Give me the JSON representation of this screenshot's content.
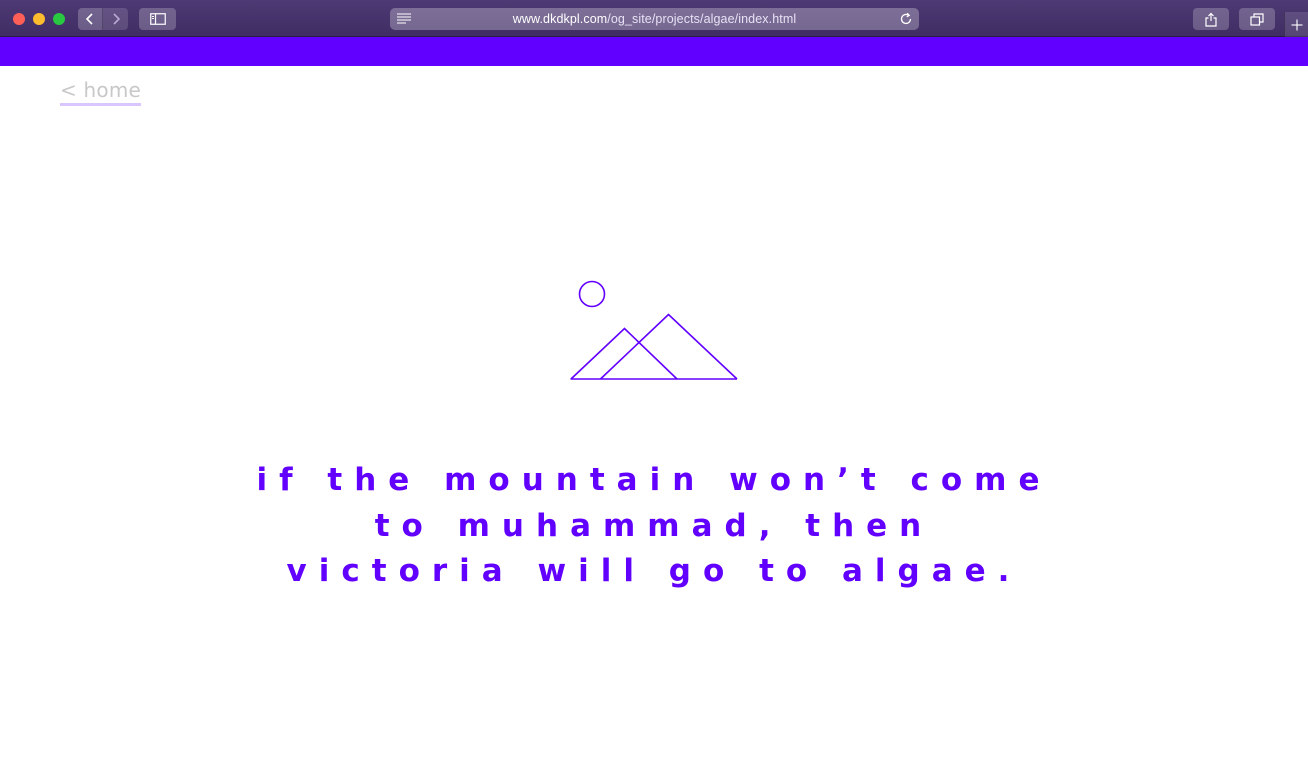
{
  "browser": {
    "url_host": "www.dkdkpl.com",
    "url_path": "/og_site/projects/algae/index.html",
    "icons": {
      "back": "chevron-left-icon",
      "forward": "chevron-right-icon",
      "sidebar": "sidebar-icon",
      "reader": "reader-lines-icon",
      "reload": "reload-icon",
      "share": "share-icon",
      "tabs": "tabs-overview-icon",
      "new_tab": "plus-icon"
    }
  },
  "page": {
    "home_link": "< home",
    "quote": "if the mountain won’t come to muhammad, then victoria will go to algae.",
    "illustration_icon": "mountains-and-sun-icon"
  },
  "colors": {
    "accent": "#6200ff",
    "home_link_text": "#c8c8c8",
    "home_link_underline": "#d9c6ff",
    "toolbar": "#4a3670"
  }
}
